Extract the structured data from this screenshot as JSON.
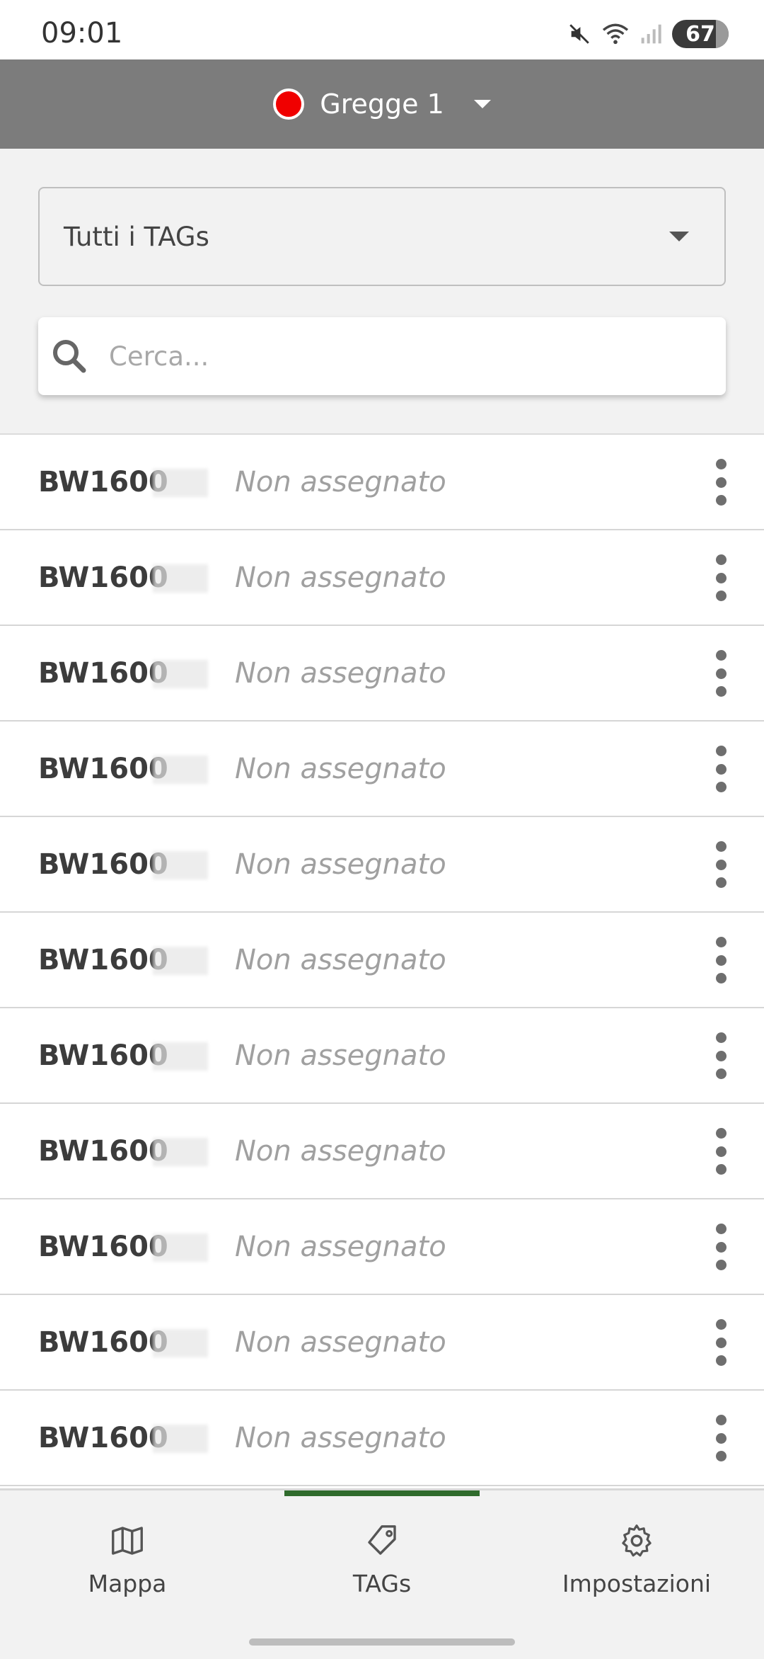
{
  "status_bar": {
    "time": "09:01",
    "battery": "67",
    "icons": [
      "mute-icon",
      "wifi-icon",
      "signal-icon",
      "battery-icon"
    ]
  },
  "header": {
    "flock_name": "Gregge 1",
    "flock_color": "#f00000"
  },
  "filter": {
    "selected": "Tutti i TAGs"
  },
  "search": {
    "placeholder": "Cerca..."
  },
  "tags": [
    {
      "id": "BW1600",
      "status": "Non assegnato"
    },
    {
      "id": "BW1600",
      "status": "Non assegnato"
    },
    {
      "id": "BW1600",
      "status": "Non assegnato"
    },
    {
      "id": "BW1600",
      "status": "Non assegnato"
    },
    {
      "id": "BW1600",
      "status": "Non assegnato"
    },
    {
      "id": "BW1600",
      "status": "Non assegnato"
    },
    {
      "id": "BW1600",
      "status": "Non assegnato"
    },
    {
      "id": "BW1600",
      "status": "Non assegnato"
    },
    {
      "id": "BW1600",
      "status": "Non assegnato"
    },
    {
      "id": "BW1600",
      "status": "Non assegnato"
    },
    {
      "id": "BW1600",
      "status": "Non assegnato"
    }
  ],
  "nav": {
    "items": [
      {
        "label": "Mappa",
        "icon": "map-icon"
      },
      {
        "label": "TAGs",
        "icon": "tag-icon"
      },
      {
        "label": "Impostazioni",
        "icon": "gear-icon"
      }
    ],
    "active": "TAGs",
    "accent": "#2f6b2c"
  },
  "colors": {
    "header_bg": "#7c7c7c",
    "page_bg": "#f2f2f2"
  }
}
